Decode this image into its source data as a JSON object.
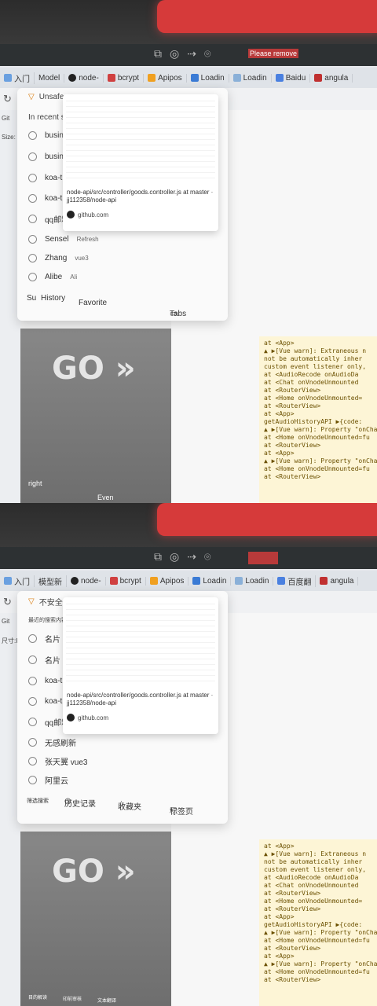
{
  "tabs_top": [
    "入门",
    "Model",
    "node-",
    "bcrypt",
    "Apipos",
    "Loadin",
    "Loadin",
    "Baidu",
    "angula"
  ],
  "tabs_bottom": [
    "入门",
    "模型新",
    "node-",
    "bcrypt",
    "Apipos",
    "Loadin",
    "Loadin",
    "百度翻",
    "angula"
  ],
  "snip": {
    "note_top": "Please remove",
    "note_bottom": ""
  },
  "top": {
    "site_label": "Unsafe",
    "recent_header": "In recent searches",
    "items": [
      "business card",
      "business card",
      "koa-t",
      "koa-t",
      "qq邮箱",
      "Sensel",
      "Zhang",
      "Alibe"
    ],
    "extra_overlap": [
      "Refresh",
      "vue3",
      "Ali"
    ],
    "footer": {
      "filter": "Su",
      "history": "History",
      "favorite": "Favorite",
      "tabs": "Tabs"
    },
    "side_text": [
      "Git",
      "Size: IP"
    ],
    "bottom_nav": [
      "right",
      "Even"
    ]
  },
  "bottom": {
    "site_label": "不安全",
    "recent_header": "最近的搜索内容",
    "items": [
      "名片",
      "名片",
      "koa-t",
      "koa-t",
      "qq邮箱",
      "无感刷新",
      "张天翼 vue3",
      "阿里云"
    ],
    "footer": {
      "filter": "筛选搜索",
      "history": "历史记录",
      "favorite": "收藏夹",
      "tabs": "标签页"
    },
    "side_text": [
      "Git",
      "尺寸:IP"
    ],
    "bottom_nav": [
      "目的解读",
      "印前审核",
      "文本翻译"
    ]
  },
  "preview": {
    "path": "node-api/src/controller/goods.controller.js at master · jj112358/node-api",
    "host": "github.com"
  },
  "console": [
    "at <App>",
    "▲ ▶[Vue warn]: Extraneous n",
    "not be automatically inher",
    "custom event listener only,",
    "at <AudioRecode onAudioDa",
    "at <Chat onVnodeUnmounted",
    "at <RouterView>",
    "at <Home onVnodeUnmounted=",
    "at <RouterView>",
    "at <App>",
    "getAudioHistoryAPI ▶{code:",
    "▲ ▶[Vue warn]: Property \"onCha",
    "at <Home onVnodeUnmounted=fu",
    "at <RouterView>",
    "at <App>",
    "▲ ▶[Vue warn]: Property \"onCha",
    "at <Home onVnodeUnmounted=fu",
    "at <RouterView>"
  ],
  "poster_text": "GO »",
  "colors": {
    "warning_bg": "#fdf5d6",
    "red_cover": "#d63a3a",
    "site_warn": "#d97706"
  }
}
